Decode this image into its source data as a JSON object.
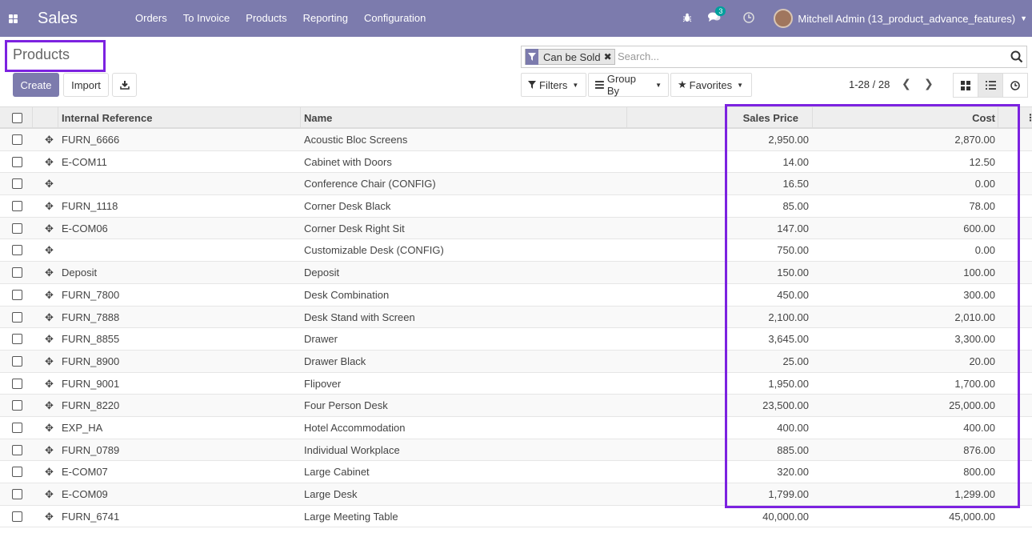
{
  "navbar": {
    "brand": "Sales",
    "menu": [
      "Orders",
      "To Invoice",
      "Products",
      "Reporting",
      "Configuration"
    ],
    "message_count": "3",
    "user": "Mitchell Admin (13_product_advance_features)"
  },
  "control": {
    "title": "Products",
    "create": "Create",
    "import": "Import",
    "facet": "Can be Sold",
    "search_placeholder": "Search...",
    "filters": "Filters",
    "group_by": "Group By",
    "favorites": "Favorites",
    "pager": "1-28 / 28"
  },
  "table": {
    "headers": [
      "Internal Reference",
      "Name",
      "Sales Price",
      "Cost"
    ],
    "rows": [
      {
        "ref": "FURN_6666",
        "name": "Acoustic Bloc Screens",
        "price": "2,950.00",
        "cost": "2,870.00"
      },
      {
        "ref": "E-COM11",
        "name": "Cabinet with Doors",
        "price": "14.00",
        "cost": "12.50"
      },
      {
        "ref": "",
        "name": "Conference Chair (CONFIG)",
        "price": "16.50",
        "cost": "0.00"
      },
      {
        "ref": "FURN_1118",
        "name": "Corner Desk Black",
        "price": "85.00",
        "cost": "78.00"
      },
      {
        "ref": "E-COM06",
        "name": "Corner Desk Right Sit",
        "price": "147.00",
        "cost": "600.00"
      },
      {
        "ref": "",
        "name": "Customizable Desk (CONFIG)",
        "price": "750.00",
        "cost": "0.00"
      },
      {
        "ref": "Deposit",
        "name": "Deposit",
        "price": "150.00",
        "cost": "100.00"
      },
      {
        "ref": "FURN_7800",
        "name": "Desk Combination",
        "price": "450.00",
        "cost": "300.00"
      },
      {
        "ref": "FURN_7888",
        "name": "Desk Stand with Screen",
        "price": "2,100.00",
        "cost": "2,010.00"
      },
      {
        "ref": "FURN_8855",
        "name": "Drawer",
        "price": "3,645.00",
        "cost": "3,300.00"
      },
      {
        "ref": "FURN_8900",
        "name": "Drawer Black",
        "price": "25.00",
        "cost": "20.00"
      },
      {
        "ref": "FURN_9001",
        "name": "Flipover",
        "price": "1,950.00",
        "cost": "1,700.00"
      },
      {
        "ref": "FURN_8220",
        "name": "Four Person Desk",
        "price": "23,500.00",
        "cost": "25,000.00"
      },
      {
        "ref": "EXP_HA",
        "name": "Hotel Accommodation",
        "price": "400.00",
        "cost": "400.00"
      },
      {
        "ref": "FURN_0789",
        "name": "Individual Workplace",
        "price": "885.00",
        "cost": "876.00"
      },
      {
        "ref": "E-COM07",
        "name": "Large Cabinet",
        "price": "320.00",
        "cost": "800.00"
      },
      {
        "ref": "E-COM09",
        "name": "Large Desk",
        "price": "1,799.00",
        "cost": "1,299.00"
      },
      {
        "ref": "FURN_6741",
        "name": "Large Meeting Table",
        "price": "40,000.00",
        "cost": "45,000.00"
      }
    ]
  },
  "colors": {
    "navbar": "#7c7bad",
    "highlight": "#7c22e0"
  }
}
